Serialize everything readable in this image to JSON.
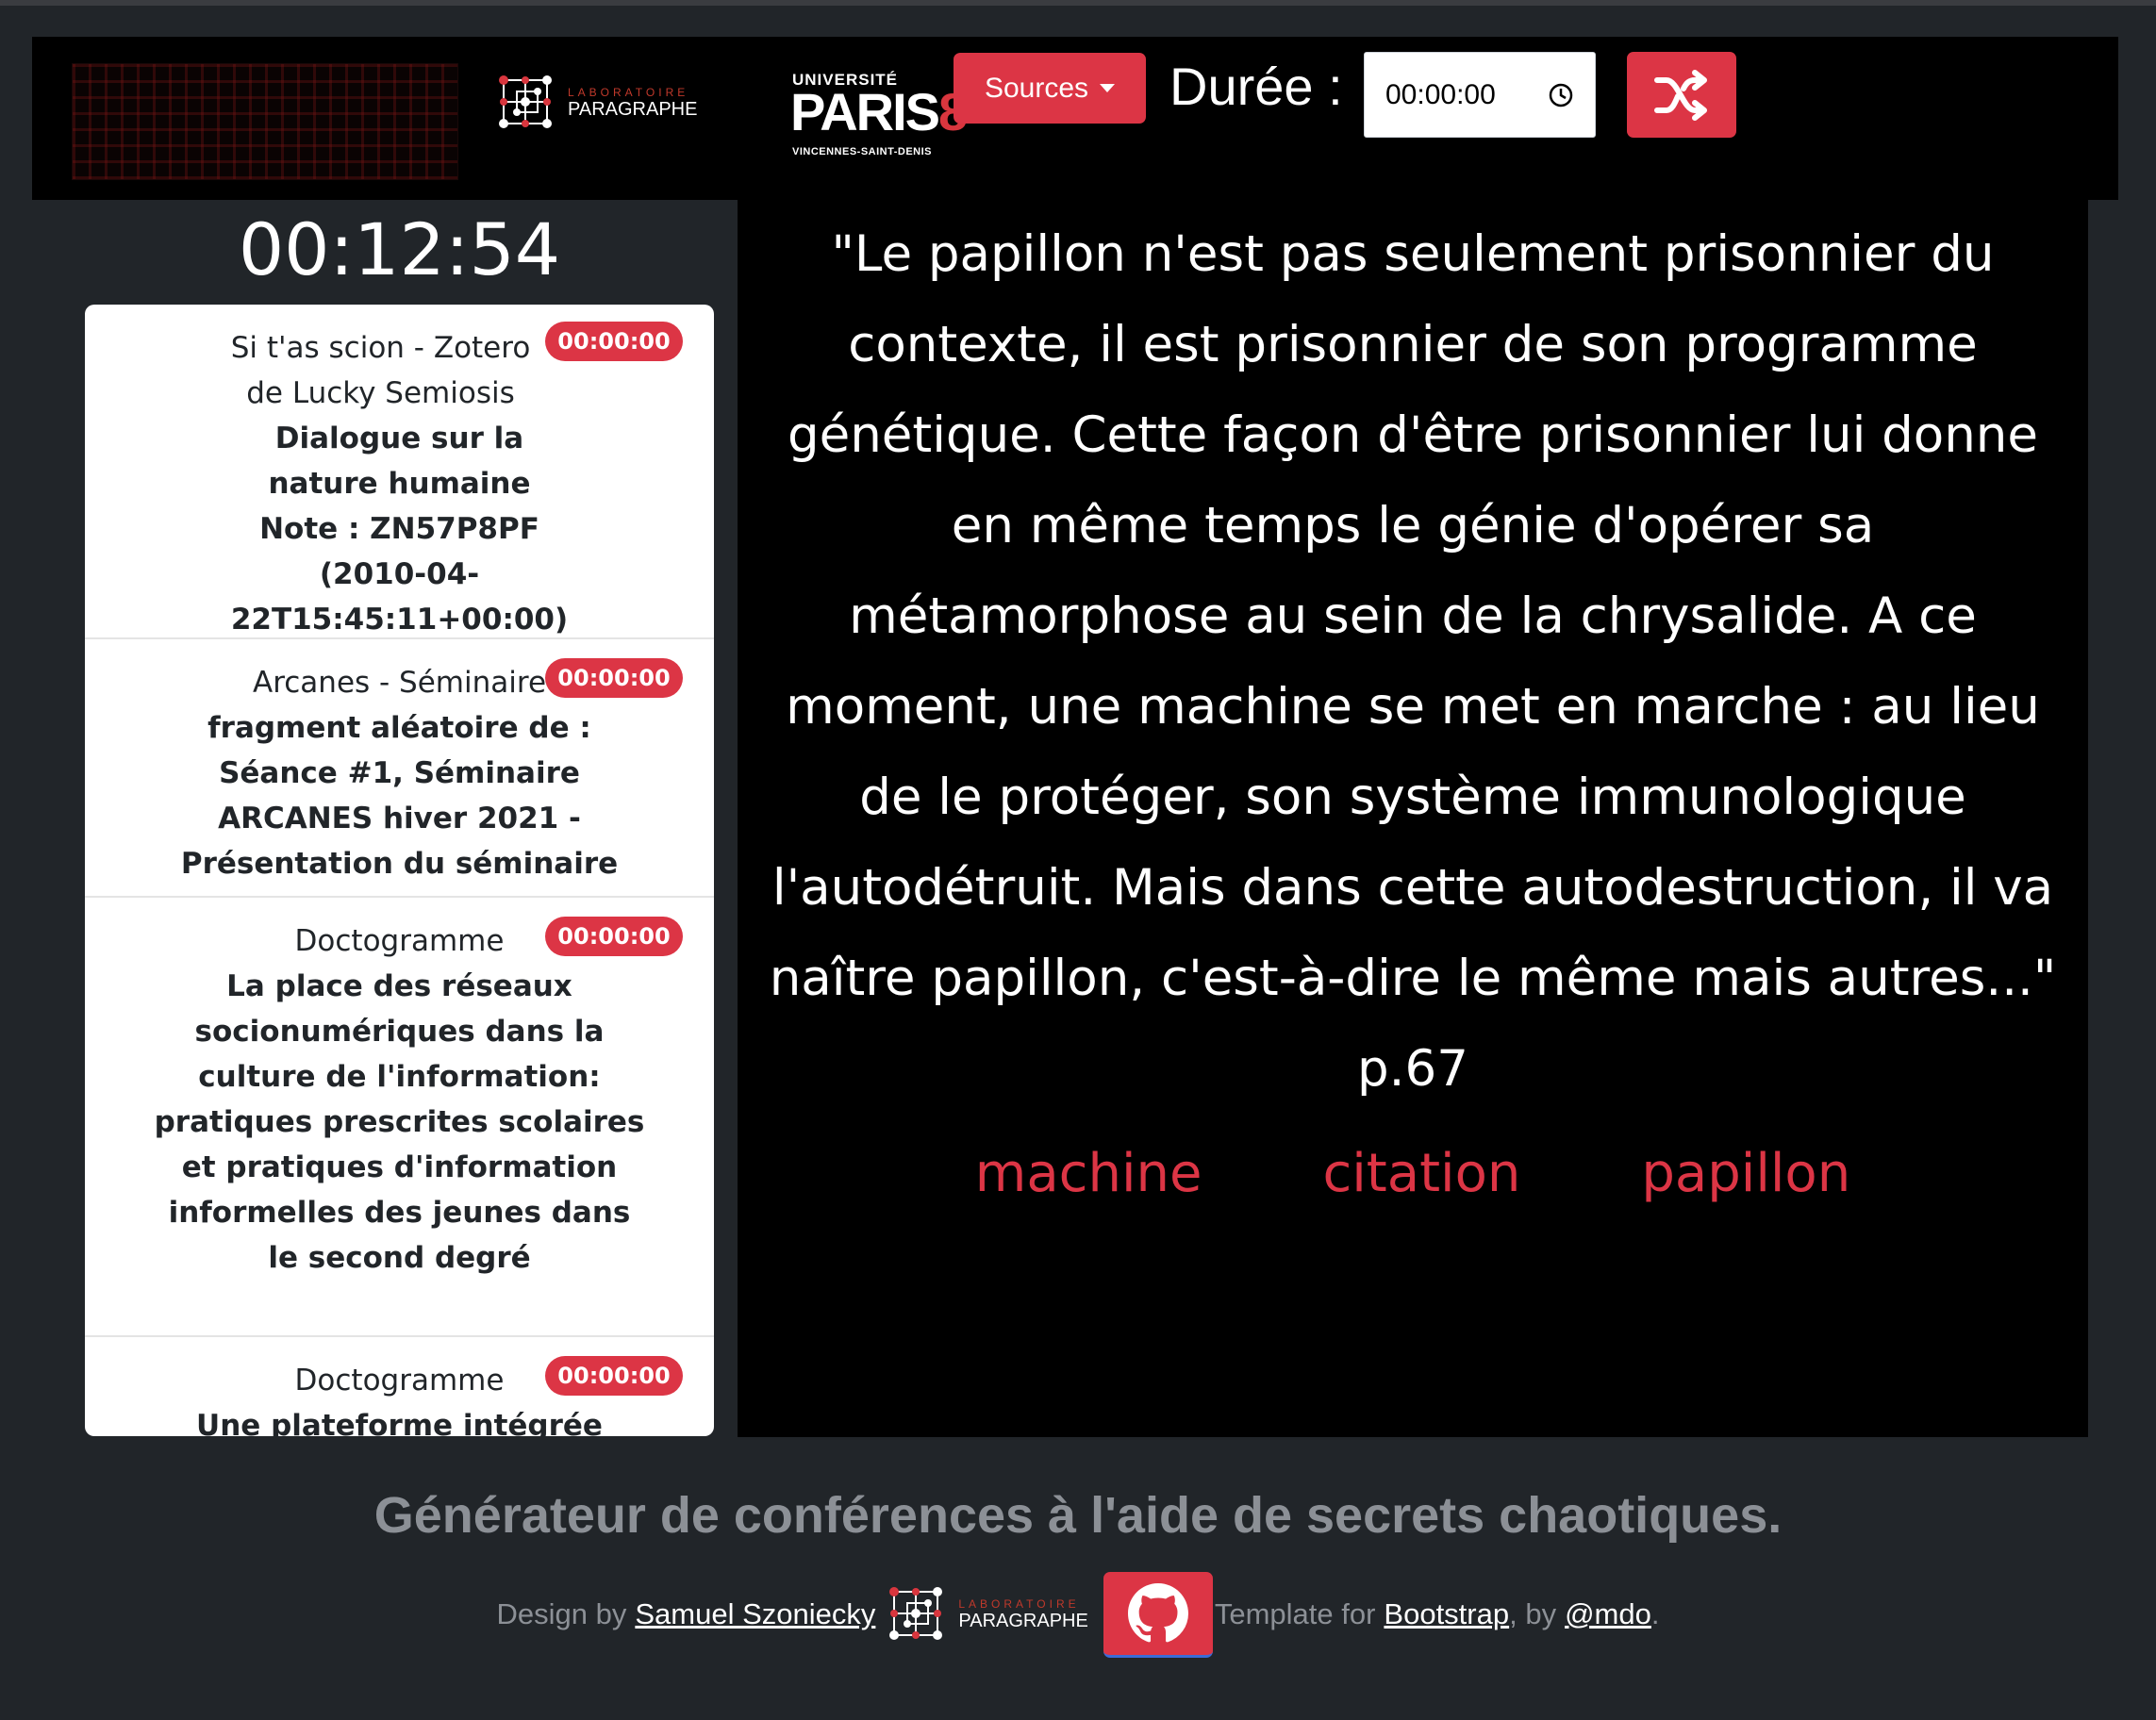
{
  "header": {
    "conference_logo_icon": "conference-banner-logo",
    "lab_logo": {
      "line1": "LABORATOIRE",
      "line2": "PARAGRAPHE"
    },
    "university_logo": {
      "top": "UNIVERSITÉ",
      "main": "PARIS",
      "number": "8",
      "bottom": "VINCENNES-SAINT-DENIS"
    },
    "sources_label": "Sources",
    "duree_label": "Durée :",
    "duree_value": "00:00:00",
    "shuffle_icon": "shuffle-icon"
  },
  "timer": "00:12:54",
  "sources_list": [
    {
      "source": "Si t'as scion - Zotero de Lucky Semiosis",
      "title": "Dialogue sur la nature humaine Note : ZN57P8PF (2010-04-22T15:45:11+00:00)",
      "duration": "00:00:00"
    },
    {
      "source": "Arcanes - Séminaire",
      "title": "fragment aléatoire de : Séance #1, Séminaire ARCANES hiver 2021 - Présentation du séminaire",
      "duration": "00:00:00"
    },
    {
      "source": "Doctogramme",
      "title": "La place des réseaux socionumériques dans la culture de l'information: pratiques prescrites scolaires et pratiques d'information informelles des jeunes dans le second degré",
      "duration": "00:00:00"
    },
    {
      "source": "Doctogramme",
      "title": "Une plateforme intégrée",
      "duration": "00:00:00"
    }
  ],
  "quote": "\"Le papillon n'est pas seulement prisonnier du contexte, il est prisonnier de son programme génétique. Cette façon d'être prisonnier lui donne en même temps le génie d'opérer sa métamorphose au sein de la chrysalide. A ce moment, une machine se met en marche : au lieu de le protéger, son système immunologique l'autodétruit. Mais dans cette autodestruction, il va naître papillon, c'est-à-dire le même mais autres...\" p.67",
  "tags": [
    "machine",
    "citation",
    "papillon"
  ],
  "footer": {
    "tagline": "Générateur de conférences à l'aide de secrets chaotiques.",
    "design_by": "Design by",
    "author": "Samuel Szoniecky",
    "template_for": "Template for",
    "bootstrap": "Bootstrap",
    "by": ", by",
    "mdo": "@mdo",
    "period": ".",
    "github_icon": "github-icon"
  },
  "colors": {
    "accent": "#dc3545",
    "background": "#212529",
    "panel": "#000000"
  }
}
